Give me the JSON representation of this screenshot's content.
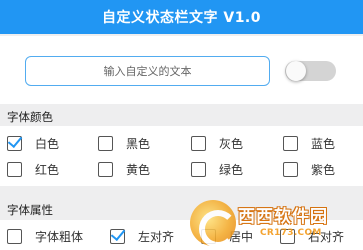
{
  "title": "自定义状态栏文字 V1.0",
  "input": {
    "placeholder": "输入自定义的文本",
    "value": ""
  },
  "toggle": {
    "on": false
  },
  "font_color": {
    "header": "字体颜色",
    "options": [
      {
        "label": "白色",
        "checked": true
      },
      {
        "label": "黑色",
        "checked": false
      },
      {
        "label": "灰色",
        "checked": false
      },
      {
        "label": "蓝色",
        "checked": false
      },
      {
        "label": "红色",
        "checked": false
      },
      {
        "label": "黄色",
        "checked": false
      },
      {
        "label": "绿色",
        "checked": false
      },
      {
        "label": "紫色",
        "checked": false
      }
    ]
  },
  "font_attr": {
    "header": "字体属性",
    "options": [
      {
        "label": "字体粗体",
        "checked": false
      },
      {
        "label": "左对齐",
        "checked": true
      },
      {
        "label": "居中",
        "checked": false
      },
      {
        "label": "右对齐",
        "checked": false
      }
    ]
  },
  "watermark": {
    "brand": "西西软件园",
    "url": "CR173.COM"
  },
  "colors": {
    "accent": "#2196f3",
    "background": "#eeeeef",
    "card": "#ffffff",
    "toggle_off": "#d4d4d4"
  }
}
